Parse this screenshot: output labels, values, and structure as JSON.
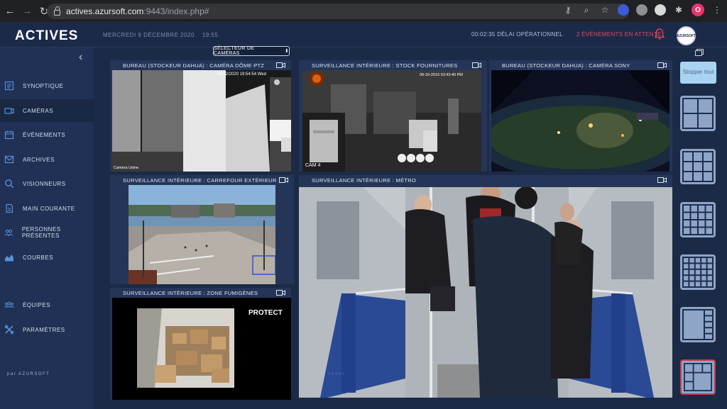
{
  "browser": {
    "url_host": "actives.azursoft.com",
    "url_rest": ":9443/index.php#",
    "profile_initial": "O"
  },
  "header": {
    "logo": "ACTIVES",
    "date": "MERCREDI 9 DÉCEMBRE 2020",
    "time": "19:55",
    "delay": "00:02:35  DÉLAI OPÉRATIONNEL",
    "events": "2 ÉVÉNEMENTS EN ATTENTE",
    "avatar_text": "AZURSOFT"
  },
  "sidebar": {
    "collapse": "‹",
    "items": [
      {
        "label": "SYNOPTIQUE",
        "icon": "synoptic-icon"
      },
      {
        "label": "CAMÉRAS",
        "icon": "camera-icon",
        "active": true
      },
      {
        "label": "ÉVÉNEMENTS",
        "icon": "calendar-icon"
      },
      {
        "label": "ARCHIVES",
        "icon": "archive-icon"
      },
      {
        "label": "VISIONNEURS",
        "icon": "search-icon"
      },
      {
        "label": "MAIN COURANTE",
        "icon": "document-icon"
      },
      {
        "label": "PERSONNES PRÉSENTES",
        "icon": "people-icon"
      },
      {
        "label": "COURBES",
        "icon": "chart-icon"
      },
      {
        "label": "ÉQUIPES",
        "icon": "team-icon"
      },
      {
        "label": "PARAMÈTRES",
        "icon": "settings-icon"
      }
    ],
    "brand": "par AZURSOFT"
  },
  "main": {
    "selector_label": "SÉLECTEUR DE CAMÉRAS",
    "tiles": [
      {
        "title": "BUREAU (STOCKEUR DAHUA) : CAMÉRA DÔME PTZ",
        "overlay_top": "09/12/2020 19:54:54 Wed",
        "overlay_bottom": "Camera Usine"
      },
      {
        "title": "SURVEILLANCE INTÉRIEURE : STOCK FOURNITURES",
        "overlay_top": "09-16-2016 03:43:40 PM",
        "overlay_bottom": "CAM 4"
      },
      {
        "title": "BUREAU (STOCKEUR DAHUA) : CAMÉRA SONY"
      },
      {
        "title": "SURVEILLANCE INTÉRIEURE : CARREFOUR EXTÉRIEUR"
      },
      {
        "title": "SURVEILLANCE INTÉRIEURE : MÉTRO"
      },
      {
        "title": "SURVEILLANCE INTÉRIEURE : ZONE FUMIGÈNES",
        "overlay_logo": "PROTECT"
      }
    ]
  },
  "toolbar": {
    "stop_label": "Stopper tout",
    "layouts": [
      "2x2",
      "3x3",
      "4x4",
      "5x5",
      "1+5",
      "2+4"
    ],
    "selected_layout": "2+4"
  },
  "colors": {
    "accent": "#5b8fd6",
    "alert": "#e8485a",
    "panel": "#203155",
    "background": "#1b2a47"
  }
}
